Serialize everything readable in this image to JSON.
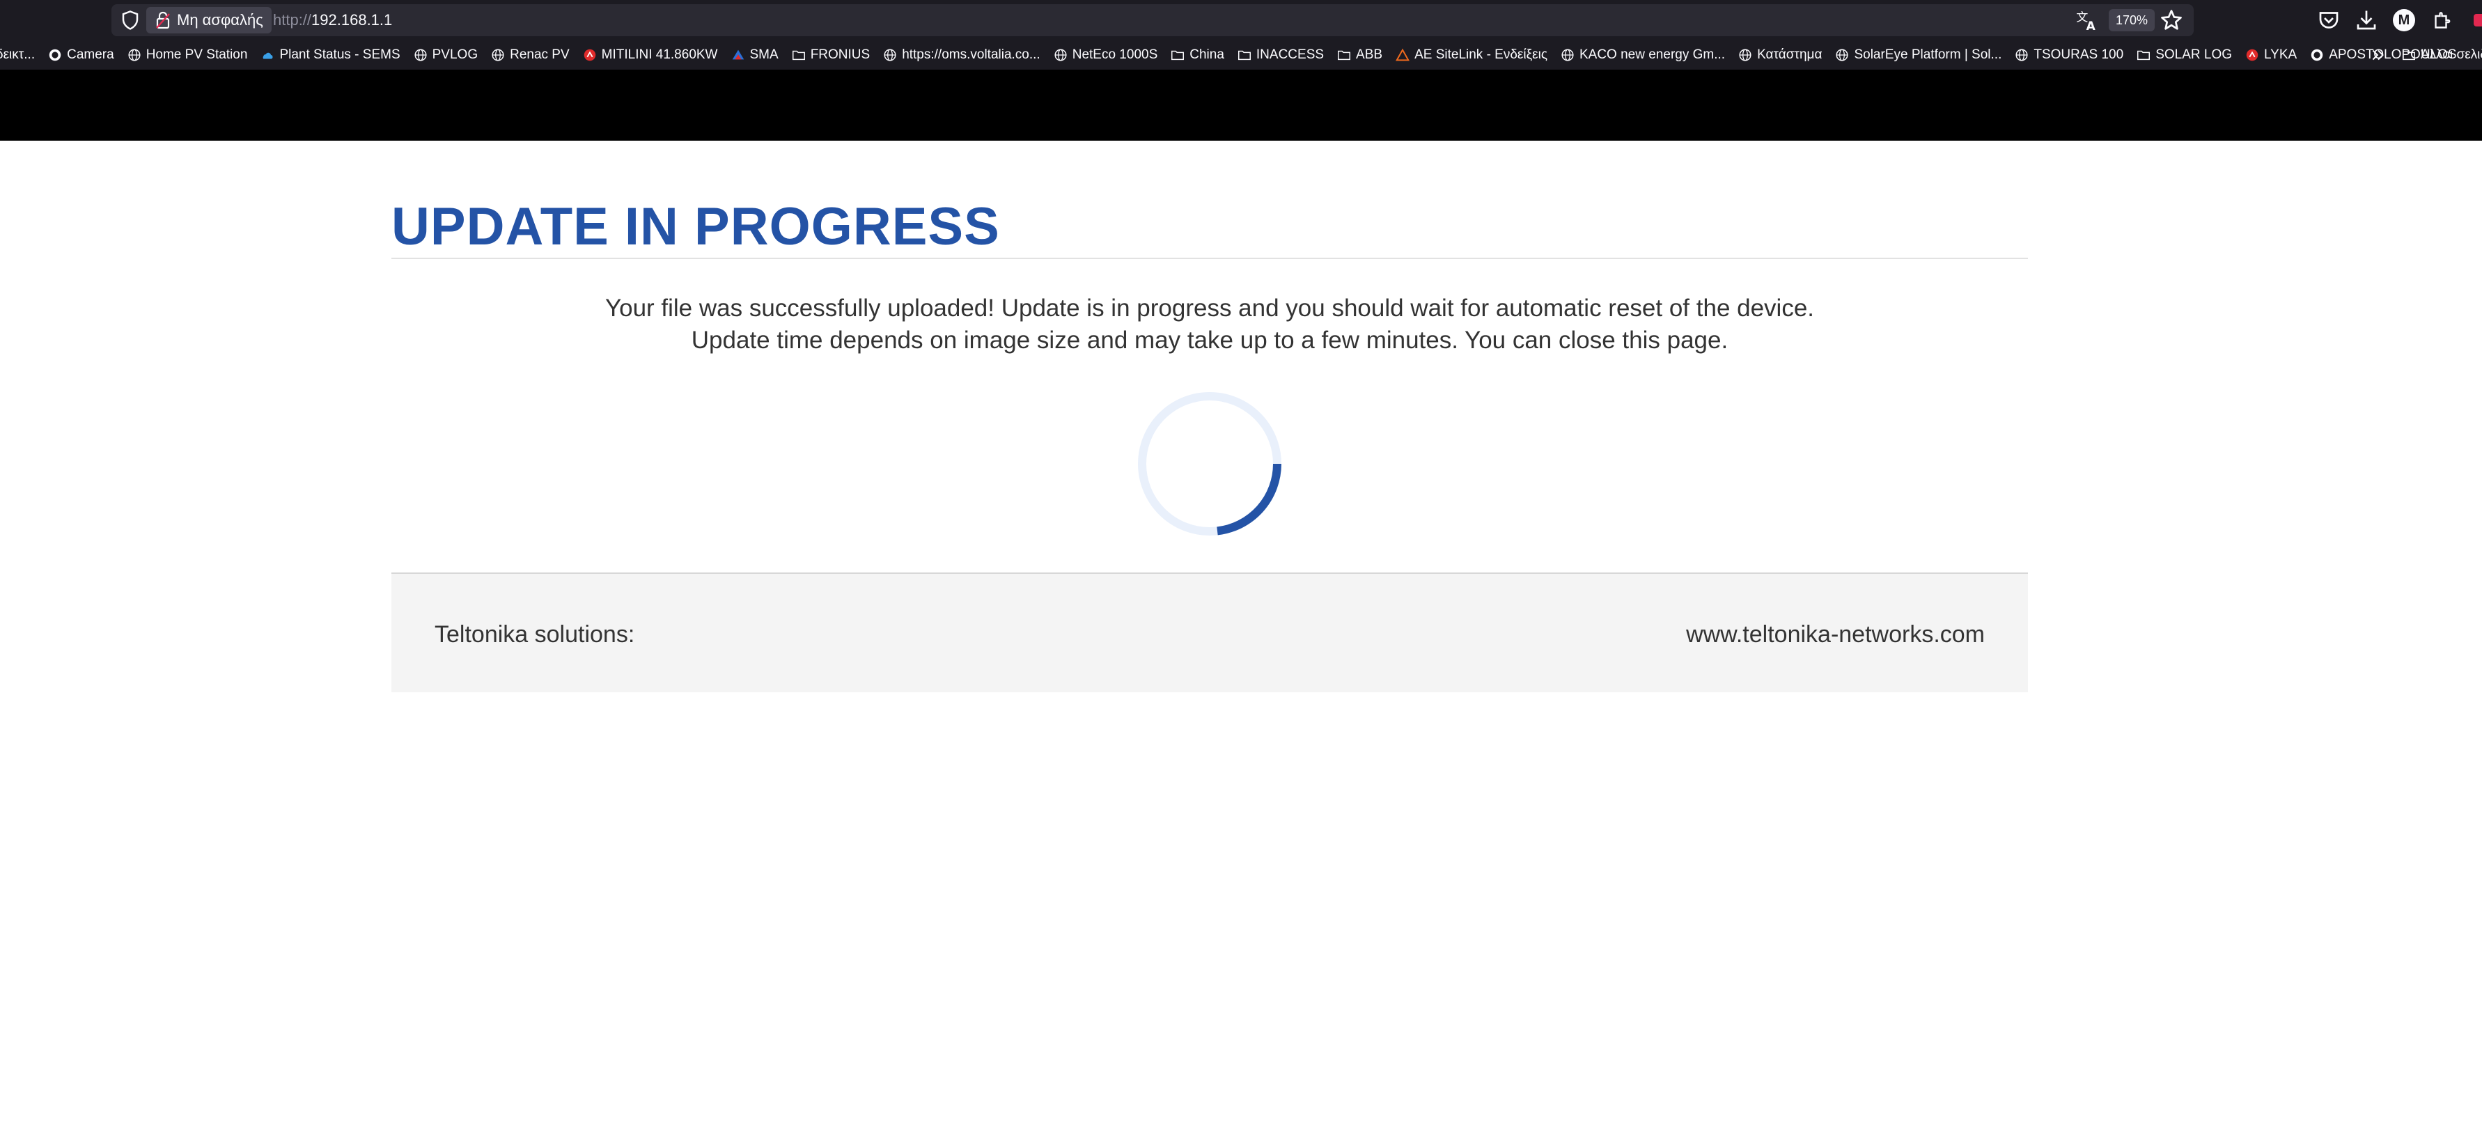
{
  "browser": {
    "security_label": "Μη ασφαλής",
    "url_protocol": "http://",
    "url_host": "192.168.1.1",
    "zoom": "170%",
    "avatar_initial": "M",
    "bookmarks": [
      {
        "label": "δεικτ...",
        "icon": "none"
      },
      {
        "label": "Camera",
        "icon": "site-icon"
      },
      {
        "label": "Home PV Station",
        "icon": "globe-icon"
      },
      {
        "label": "Plant Status - SEMS",
        "icon": "cloud-icon"
      },
      {
        "label": "PVLOG",
        "icon": "globe-icon"
      },
      {
        "label": "Renac PV",
        "icon": "globe-icon"
      },
      {
        "label": "MITILINI 41.860KW",
        "icon": "red-logo-icon"
      },
      {
        "label": "SMA",
        "icon": "sma-logo-icon"
      },
      {
        "label": "FRONIUS",
        "icon": "folder-icon"
      },
      {
        "label": "https://oms.voltalia.co...",
        "icon": "globe-icon"
      },
      {
        "label": "NetEco 1000S",
        "icon": "globe-icon"
      },
      {
        "label": "China",
        "icon": "folder-icon"
      },
      {
        "label": "INACCESS",
        "icon": "folder-icon"
      },
      {
        "label": "ABB",
        "icon": "folder-icon"
      },
      {
        "label": "AE SiteLink - Ενδείξεις",
        "icon": "ae-logo-icon"
      },
      {
        "label": "KACO new energy Gm...",
        "icon": "globe-icon"
      },
      {
        "label": "Κατάστημα",
        "icon": "globe-icon"
      },
      {
        "label": "SolarEye Platform | Sol...",
        "icon": "globe-icon"
      },
      {
        "label": "TSOURAS 100",
        "icon": "globe-icon"
      },
      {
        "label": "SOLAR LOG",
        "icon": "folder-icon"
      },
      {
        "label": "LYKA",
        "icon": "red-logo-icon"
      },
      {
        "label": "APOSTOLOPOULOS",
        "icon": "site-icon"
      }
    ],
    "other_bookmarks_label": "Άλλοι σελιδ"
  },
  "page": {
    "heading": "UPDATE IN PROGRESS",
    "message_line1": "Your file was successfully uploaded! Update is in progress and you should wait for automatic reset of the device.",
    "message_line2": "Update time depends on image size and may take up to a few minutes. You can close this page.",
    "spinner_state": "loading",
    "footer_left": "Teltonika solutions:",
    "footer_right": "www.teltonika-networks.com"
  },
  "colors": {
    "accent": "#2453a6",
    "spinner_track": "#e9f0fb",
    "chrome_bg": "#1c1b22",
    "urlbar_bg": "#2b2a33"
  }
}
